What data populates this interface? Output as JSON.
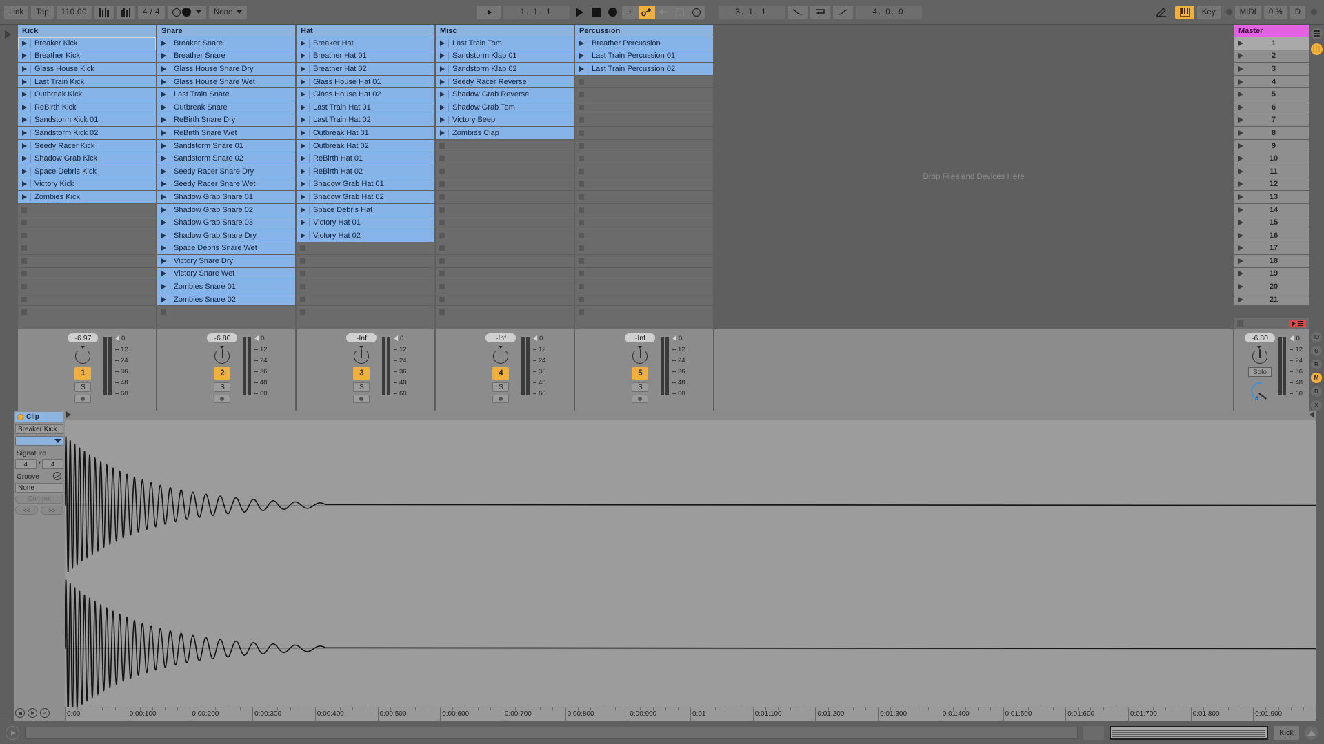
{
  "topbar": {
    "link": "Link",
    "tap": "Tap",
    "tempo": "110.00",
    "time_signature": "4 / 4",
    "metronome_icon": "metronome-icon",
    "quantization": "None",
    "punch_icon": "punch-in-icon",
    "arrangement_position": "1.  1.  1",
    "play_icon": "play-icon",
    "stop_icon": "stop-icon",
    "record_icon": "record-icon",
    "new_icon": "plus-icon",
    "automation_icon": "automation-arm-icon",
    "back_icon": "back-arrow-icon",
    "loop_icon": "loop-icon",
    "midi_arm_icon": "midi-arm-icon",
    "loop_position": "3.  1.  1",
    "fade_in_icon": "fade-in-icon",
    "loop_switch_icon": "loop-switch-icon",
    "fade_out_icon": "fade-out-icon",
    "loop_length": "4.  0.  0",
    "draw_icon": "pencil-icon",
    "keyboard_icon": "computer-midi-keyboard-icon",
    "key": "Key",
    "midi": "MIDI",
    "cpu_load": "0 %",
    "disk": "D"
  },
  "session": {
    "drop_hint": "Drop Files and Devices Here",
    "tracks": [
      {
        "name": "Kick",
        "mixer": {
          "volume": "-6.97",
          "number": "1",
          "solo": "S",
          "record": "rec-icon"
        },
        "clips": [
          "Breaker Kick",
          "Breather Kick",
          "Glass House Kick",
          "Last Train Kick",
          "Outbreak Kick",
          "ReBirth Kick",
          "Sandstorm Kick 01",
          "Sandstorm Kick 02",
          "Seedy Racer Kick",
          "Shadow Grab Kick",
          "Space Debris Kick",
          "Victory Kick",
          "Zombies Kick"
        ]
      },
      {
        "name": "Snare",
        "mixer": {
          "volume": "-6.80",
          "number": "2",
          "solo": "S",
          "record": "rec-icon"
        },
        "clips": [
          "Breaker Snare",
          "Breather Snare",
          "Glass House Snare Dry",
          "Glass House Snare Wet",
          "Last Train Snare",
          "Outbreak Snare",
          "ReBirth Snare Dry",
          "ReBirth Snare Wet",
          "Sandstorm Snare 01",
          "Sandstorm Snare 02",
          "Seedy Racer Snare Dry",
          "Seedy Racer Snare Wet",
          "Shadow Grab Snare 01",
          "Shadow Grab Snare 02",
          "Shadow Grab Snare 03",
          "Shadow Grab Snare Dry",
          "Space Debris Snare Wet",
          "Victory Snare Dry",
          "Victory Snare Wet",
          "Zombies Snare 01",
          "Zombies Snare 02"
        ]
      },
      {
        "name": "Hat",
        "mixer": {
          "volume": "-Inf",
          "number": "3",
          "solo": "S",
          "record": "rec-icon"
        },
        "clips": [
          "Breaker Hat",
          "Breather Hat 01",
          "Breather Hat 02",
          "Glass House Hat 01",
          "Glass House Hat 02",
          "Last Train Hat 01",
          "Last Train Hat 02",
          "Outbreak Hat 01",
          "Outbreak Hat 02",
          "ReBirth Hat 01",
          "ReBirth Hat 02",
          "Shadow Grab Hat 01",
          "Shadow Grab Hat 02",
          "Space Debris Hat",
          "Victory Hat 01",
          "Victory Hat 02"
        ]
      },
      {
        "name": "Misc",
        "mixer": {
          "volume": "-Inf",
          "number": "4",
          "solo": "S",
          "record": "rec-icon"
        },
        "clips": [
          "Last Train Tom",
          "Sandstorm Klap 01",
          "Sandstorm Klap 02",
          "Seedy Racer Reverse",
          "Shadow Grab Reverse",
          "Shadow Grab Tom",
          "Victory Beep",
          "Zombies Clap"
        ]
      },
      {
        "name": "Percussion",
        "mixer": {
          "volume": "-Inf",
          "number": "5",
          "solo": "S",
          "record": "rec-icon"
        },
        "clips": [
          "Breather Percussion",
          "Last Train Percussion 01",
          "Last Train Percussion 02"
        ]
      }
    ],
    "selected_clip": {
      "track": 0,
      "row": 0
    },
    "master": {
      "name": "Master",
      "scenes": [
        "1",
        "2",
        "3",
        "4",
        "5",
        "6",
        "7",
        "8",
        "9",
        "10",
        "11",
        "12",
        "13",
        "14",
        "15",
        "16",
        "17",
        "18",
        "19",
        "20",
        "21"
      ],
      "volume": "-6.80",
      "solo_label": "Solo",
      "stop_all_icon": "stop-all-clips-icon"
    },
    "meter_scale": [
      "0",
      "12",
      "24",
      "36",
      "48",
      "60"
    ],
    "right_strip": {
      "io_icon": "in-out-icon",
      "sends_icon": "sends-icon",
      "returns_icon": "returns-icon",
      "mixer_icon": "mixer-icon",
      "delay_icon": "track-delay-icon",
      "crossfade_icon": "crossfade-icon"
    }
  },
  "clip_panel": {
    "title": "Clip",
    "clip_name": "Breaker Kick",
    "color_swatch": "clip-color-swatch",
    "signature_label": "Signature",
    "sig_numerator": "4",
    "sig_denominator": "4",
    "sig_slash": "/",
    "groove_label": "Groove",
    "groove_value": "None",
    "commit_label": "Commit",
    "prev_label": "<<",
    "next_label": ">>",
    "foot_icons": [
      "loop-toggle-icon",
      "play-clip-icon",
      "confirm-icon"
    ]
  },
  "waveform": {
    "ruler_ticks": [
      "0:00",
      "0:00:100",
      "0:00:200",
      "0:00:300",
      "0:00:400",
      "0:00:500",
      "0:00:600",
      "0:00:700",
      "0:00:800",
      "0:00:900",
      "0:01",
      "0:01:100",
      "0:01:200",
      "0:01:300",
      "0:01:400",
      "0:01:500",
      "0:01:600",
      "0:01:700",
      "0:01:800",
      "0:01:900"
    ],
    "channels": 2,
    "description": "decaying-sine-kick-waveform"
  },
  "statusbar": {
    "help_icon": "help-view-icon",
    "message": "",
    "overview_label": "arrangement-overview",
    "track_label": "Kick",
    "expand_icon": "expand-up-icon"
  },
  "colors": {
    "clip_blue": "#87b4e8",
    "track_header_blue": "#8cb4de",
    "master_magenta": "#e262e2",
    "accent_orange": "#f0b040",
    "stop_red": "#e04646",
    "cue_blue": "#3f8fd8",
    "bg_gray": "#5f5f5f",
    "mixer_gray": "#8c8c8c",
    "wave_gray": "#9c9c9c"
  }
}
